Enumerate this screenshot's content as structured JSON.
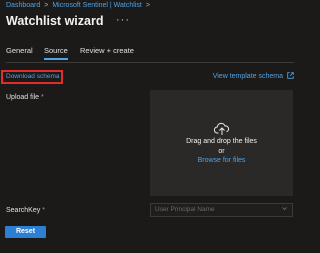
{
  "breadcrumb": {
    "items": [
      "Dashboard",
      "Microsoft Sentinel | Watchlist"
    ],
    "separator": ">"
  },
  "header": {
    "title": "Watchlist wizard",
    "more_label": "···"
  },
  "tabs": [
    {
      "label": "General",
      "active": false
    },
    {
      "label": "Source",
      "active": true
    },
    {
      "label": "Review + create",
      "active": false
    }
  ],
  "source": {
    "download_schema": "Download schema",
    "view_template_schema": "View template schema",
    "external_icon": "external-link-icon",
    "upload_label": "Upload file",
    "required_mark": "*",
    "dropzone": {
      "icon": "cloud-upload-icon",
      "text": "Drag and drop the files",
      "or": "or",
      "browse": "Browse for files"
    },
    "searchkey_label": "SearchKey",
    "searchkey_placeholder": "User Principal Name",
    "reset_label": "Reset"
  },
  "colors": {
    "background": "#1b1a19",
    "link": "#4ea3e8",
    "highlight_border": "#e22b2b",
    "primary_button": "#2b7fd4"
  }
}
